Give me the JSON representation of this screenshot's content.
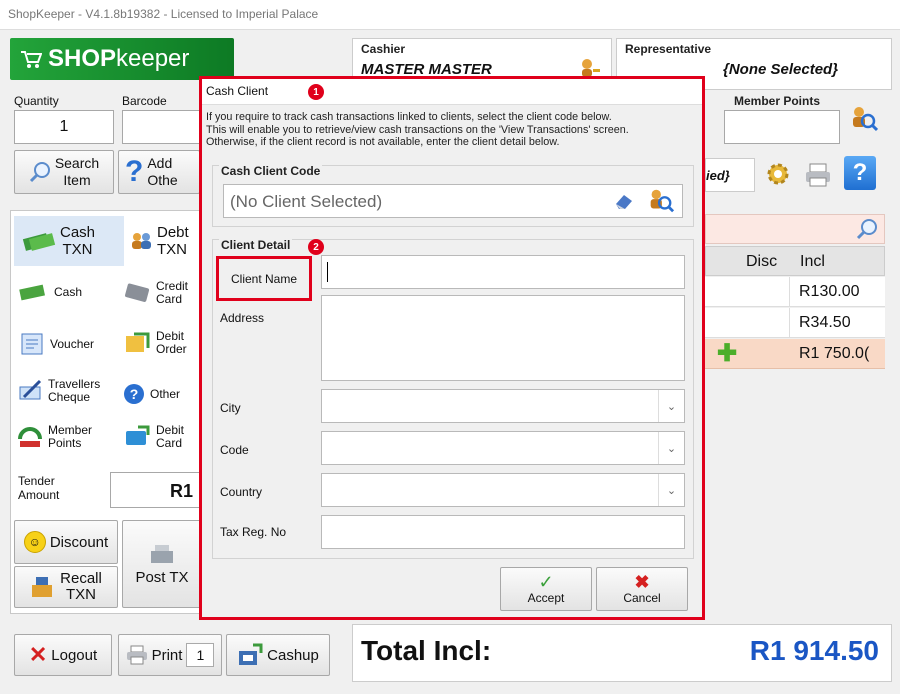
{
  "window_title": "ShopKeeper - V4.1.8b19382 - Licensed to Imperial Palace",
  "logo": {
    "brand_bold": "SHOP",
    "brand_light": "keeper"
  },
  "cashier": {
    "label": "Cashier",
    "value": "MASTER MASTER"
  },
  "representative": {
    "label": "Representative",
    "value": "{None Selected}"
  },
  "quantity": {
    "label": "Quantity",
    "value": "1"
  },
  "barcode": {
    "label": "Barcode",
    "value": ""
  },
  "member_points": {
    "label": "Member Points",
    "value": ""
  },
  "search_item": {
    "line1": "Search",
    "line2": "Item"
  },
  "add_other": {
    "line1": "Add",
    "line2": "Othe"
  },
  "selected_client_partial": "ied}",
  "txn_tabs": [
    {
      "line1": "Cash",
      "line2": "TXN"
    },
    {
      "line1": "Debt",
      "line2": "TXN"
    }
  ],
  "payment_methods": [
    {
      "line1": "Cash",
      "line2": ""
    },
    {
      "line1": "Credit",
      "line2": "Card"
    },
    {
      "line1": "Voucher",
      "line2": ""
    },
    {
      "line1": "Debit",
      "line2": "Order"
    },
    {
      "line1": "Travellers",
      "line2": "Cheque"
    },
    {
      "line1": "Other",
      "line2": ""
    },
    {
      "line1": "Member",
      "line2": "Points"
    },
    {
      "line1": "Debit",
      "line2": "Card"
    }
  ],
  "tender": {
    "label1": "Tender",
    "label2": "Amount",
    "value": "R1"
  },
  "discount_label": "Discount",
  "post_txn_label": "Post TX",
  "recall": {
    "line1": "Recall",
    "line2": "TXN"
  },
  "bottom_buttons": {
    "logout": "Logout",
    "print": "Print",
    "print_copies": "1",
    "cashup": "Cashup"
  },
  "grid": {
    "headers": [
      "Disc",
      "Incl"
    ],
    "rows": [
      "R130.00",
      "R34.50",
      "R1 750.0("
    ]
  },
  "total": {
    "label": "Total Incl:",
    "value": "R1 914.50"
  },
  "dialog": {
    "title": "Cash Client",
    "badge1": "1",
    "badge2": "2",
    "info_lines": [
      "If you require to track cash transactions linked to clients, select the client code below.",
      "This will enable you to retrieve/view cash transactions on the 'View Transactions' screen.",
      "Otherwise, if the client record is not available, enter the client detail below."
    ],
    "client_code_label": "Cash Client Code",
    "client_code_value": "(No Client Selected)",
    "client_detail_label": "Client Detail",
    "fields": {
      "client_name": "Client Name",
      "address": "Address",
      "city": "City",
      "code": "Code",
      "country": "Country",
      "tax": "Tax Reg. No"
    },
    "accept": "Accept",
    "cancel": "Cancel"
  },
  "colors": {
    "accent_red": "#e0001b",
    "total_blue": "#1a56c4",
    "logo_green": "#1e8f2e",
    "highlight_row": "#f9d9c6"
  }
}
